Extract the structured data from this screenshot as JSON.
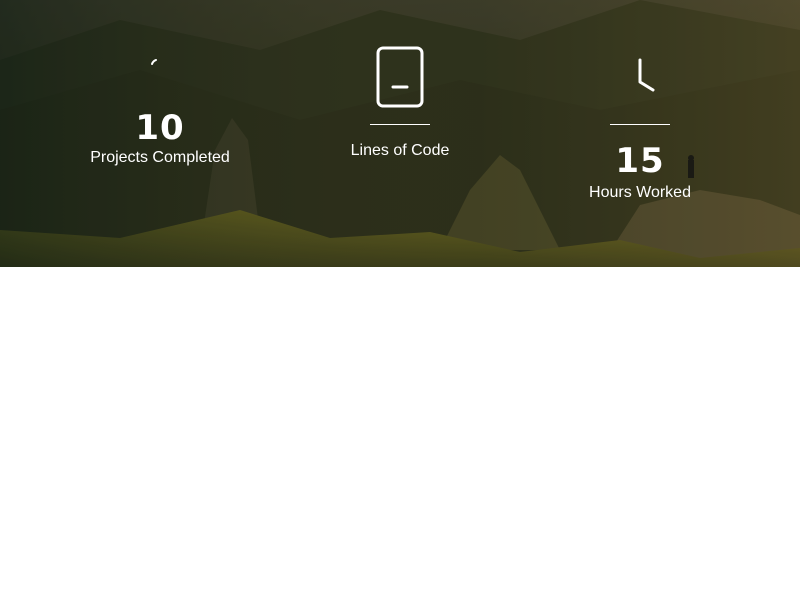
{
  "stats": [
    {
      "icon": "spinner-icon",
      "number": "10",
      "label": "Projects Completed"
    },
    {
      "icon": "mobile-device-icon",
      "number": "",
      "label": "Lines of Code"
    },
    {
      "icon": "clock-icon",
      "number": "15",
      "label": "Hours Worked"
    }
  ],
  "colors": {
    "text": "#ffffff",
    "background": "#ffffff",
    "hero_dark": "#2f3a24"
  }
}
